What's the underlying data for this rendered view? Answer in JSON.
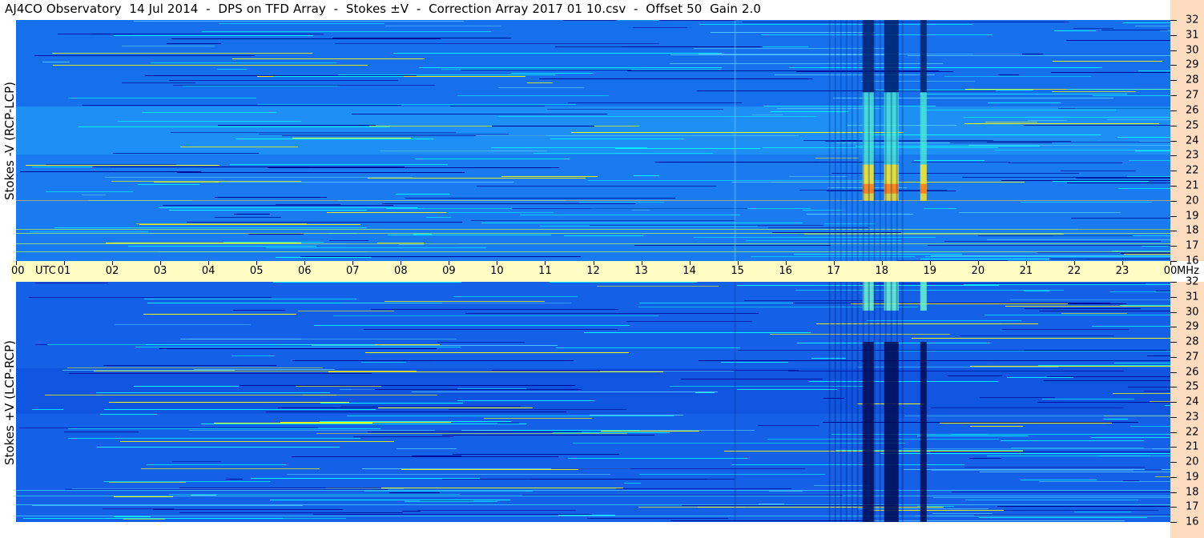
{
  "title": "AJ4CO Observatory  14 Jul 2014  -  DPS on TFD Array  -  Stokes ±V  -  Correction Array 2017 01 10.csv  -  Offset 50  Gain 2.0",
  "chart_data": [
    {
      "type": "heatmap",
      "ylabel": "Stokes -V (RCP-LCP)",
      "x_ticks": [
        "00",
        "UTC",
        "01",
        "02",
        "03",
        "04",
        "05",
        "06",
        "07",
        "08",
        "09",
        "10",
        "11",
        "12",
        "13",
        "14",
        "15",
        "16",
        "17",
        "18",
        "19",
        "20",
        "21",
        "22",
        "23",
        "00",
        "MHz"
      ],
      "y_ticks": [
        "32",
        "31",
        "30",
        "29",
        "28",
        "27",
        "26",
        "25",
        "24",
        "23",
        "22",
        "21",
        "20",
        "19",
        "18",
        "17",
        "16"
      ],
      "x_range_hours": [
        0,
        24
      ],
      "y_range_mhz": [
        16,
        32
      ],
      "colormap": [
        "#00008f",
        "#0000ff",
        "#0080ff",
        "#00ffff",
        "#ffff00",
        "#ff8000",
        "#ff0000"
      ]
    },
    {
      "type": "heatmap",
      "ylabel": "Stokes +V (LCP-RCP)",
      "x_ticks": [
        "00",
        "UTC",
        "01",
        "02",
        "03",
        "04",
        "05",
        "06",
        "07",
        "08",
        "09",
        "10",
        "11",
        "12",
        "13",
        "14",
        "15",
        "16",
        "17",
        "18",
        "19",
        "20",
        "21",
        "22",
        "23",
        "00",
        "MHz"
      ],
      "y_ticks": [
        "32",
        "31",
        "30",
        "29",
        "28",
        "27",
        "26",
        "25",
        "24",
        "23",
        "22",
        "21",
        "20",
        "19",
        "18",
        "17",
        "16"
      ],
      "x_range_hours": [
        0,
        24
      ],
      "y_range_mhz": [
        16,
        32
      ],
      "colormap": [
        "#00008f",
        "#0000ff",
        "#0080ff",
        "#00ffff",
        "#ffff00",
        "#ff8000",
        "#ff0000"
      ]
    }
  ]
}
